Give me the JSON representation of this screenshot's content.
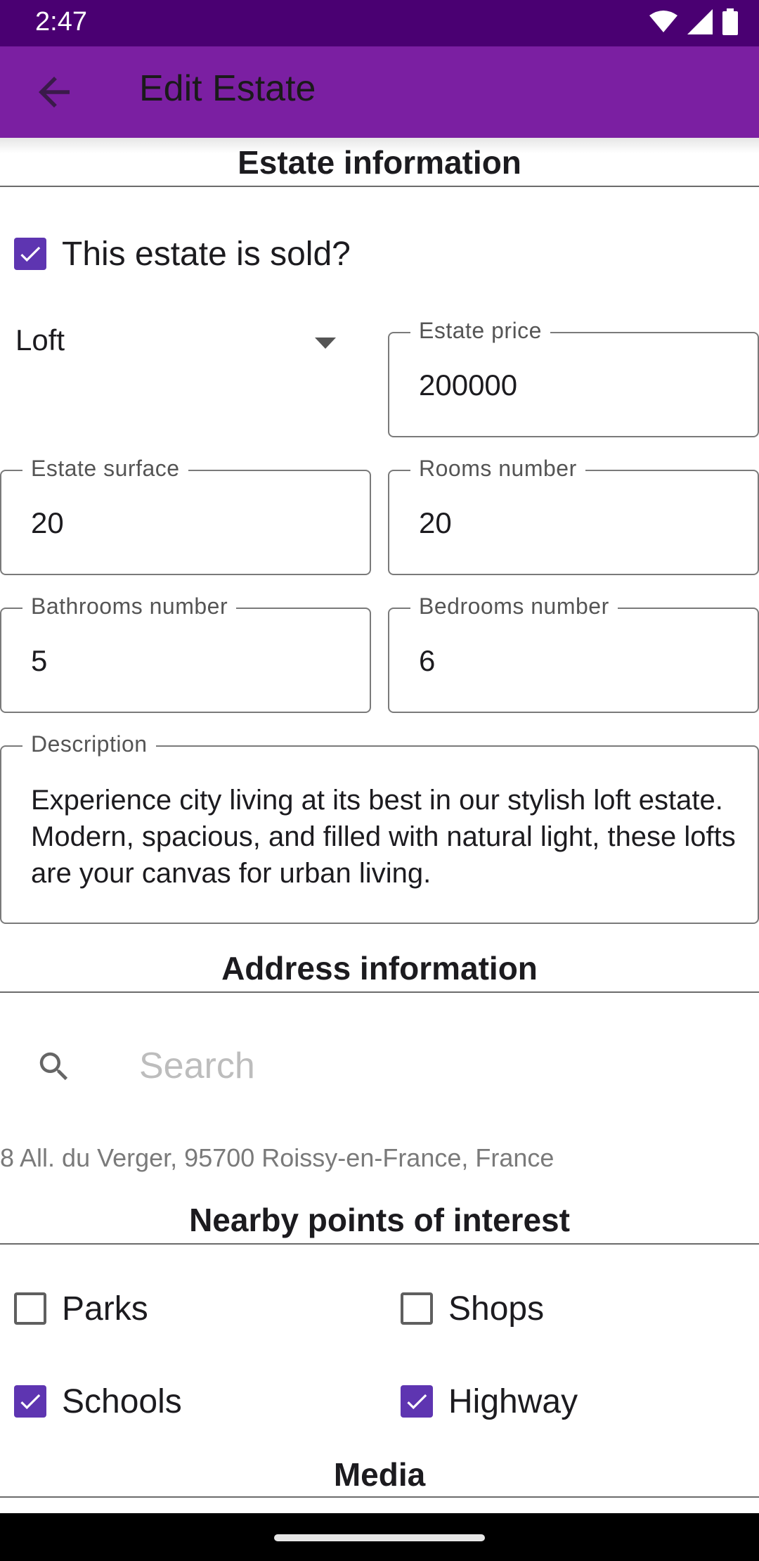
{
  "status_bar": {
    "time": "2:47",
    "icons": [
      "wifi-icon",
      "signal-icon",
      "battery-icon"
    ]
  },
  "app_bar": {
    "title": "Edit Estate",
    "back_icon": "arrow-back-icon"
  },
  "estate_section": {
    "title": "Estate information",
    "sold_label": "This estate is sold?",
    "sold_checked": true,
    "type_value": "Loft",
    "price_label": "Estate price",
    "price_value": "200000",
    "surface_label": "Estate surface",
    "surface_value": "20",
    "rooms_label": "Rooms number",
    "rooms_value": "20",
    "bathrooms_label": "Bathrooms number",
    "bathrooms_value": "5",
    "bedrooms_label": "Bedrooms number",
    "bedrooms_value": "6",
    "description_label": "Description",
    "description_value": "Experience city living at its best in our stylish loft estate. Modern, spacious, and filled with natural light, these lofts are your canvas for urban living."
  },
  "address_section": {
    "title": "Address information",
    "search_placeholder": "Search",
    "address_text": "8 All. du Verger, 95700 Roissy-en-France, France"
  },
  "poi_section": {
    "title": "Nearby points of interest",
    "items": [
      {
        "label": "Parks",
        "checked": false
      },
      {
        "label": "Shops",
        "checked": false
      },
      {
        "label": "Schools",
        "checked": true
      },
      {
        "label": "Highway",
        "checked": true
      }
    ]
  },
  "media_section": {
    "title": "Media"
  },
  "colors": {
    "primary": "#7b1fa2",
    "primary_dark": "#4a0072",
    "checkbox": "#5e35b1"
  }
}
